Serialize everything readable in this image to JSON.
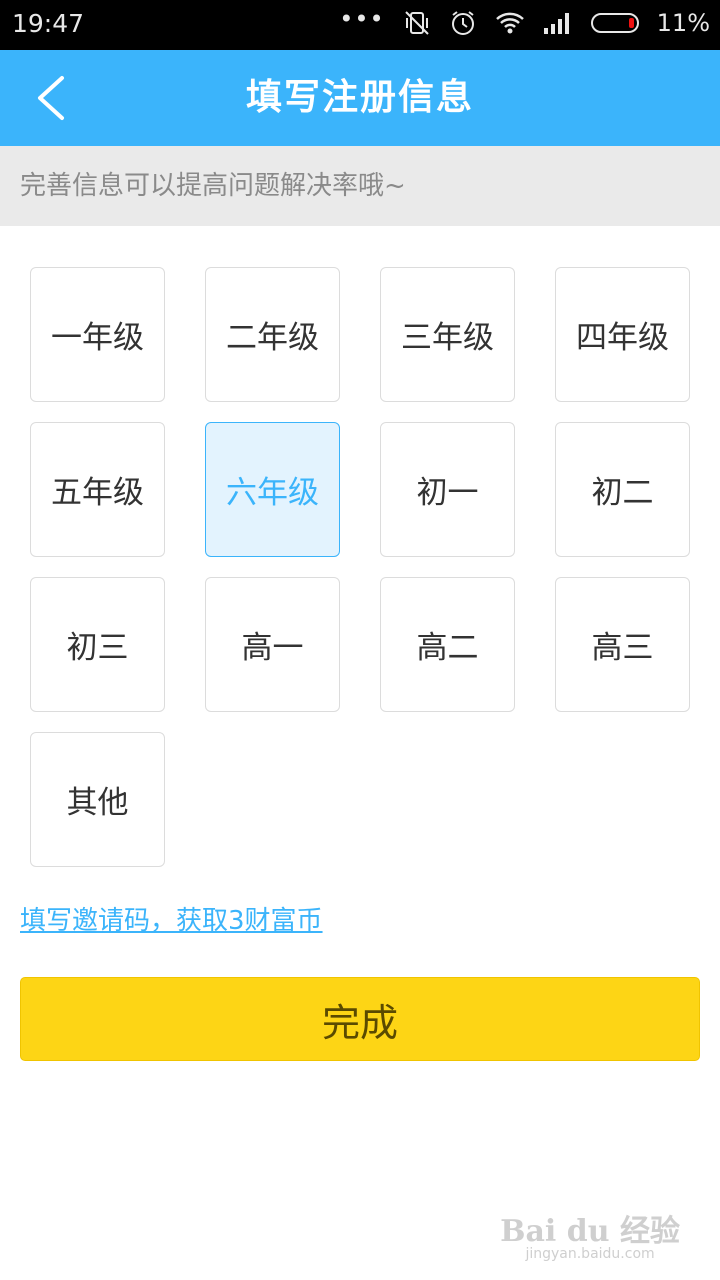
{
  "status_bar": {
    "time": "19:47",
    "battery_percent": "11%",
    "battery_level": 0.11,
    "icons": [
      "more-dots-icon",
      "vibrate-icon",
      "alarm-icon",
      "wifi-icon",
      "signal-icon",
      "battery-icon"
    ]
  },
  "header": {
    "title": "填写注册信息",
    "back_icon": "back-arrow-icon"
  },
  "hint": "完善信息可以提高问题解决率哦~",
  "grades": {
    "items": [
      "一年级",
      "二年级",
      "三年级",
      "四年级",
      "五年级",
      "六年级",
      "初一",
      "初二",
      "初三",
      "高一",
      "高二",
      "高三",
      "其他"
    ],
    "selected": "六年级"
  },
  "invite_link": "填写邀请码，获取3财富币",
  "done_button": "完成",
  "watermark": {
    "logo": "Bai du 经验",
    "url": "jingyan.baidu.com"
  },
  "colors": {
    "primary": "#3bb4fb",
    "button": "#fdd515",
    "selected_bg": "#e3f3fe"
  }
}
